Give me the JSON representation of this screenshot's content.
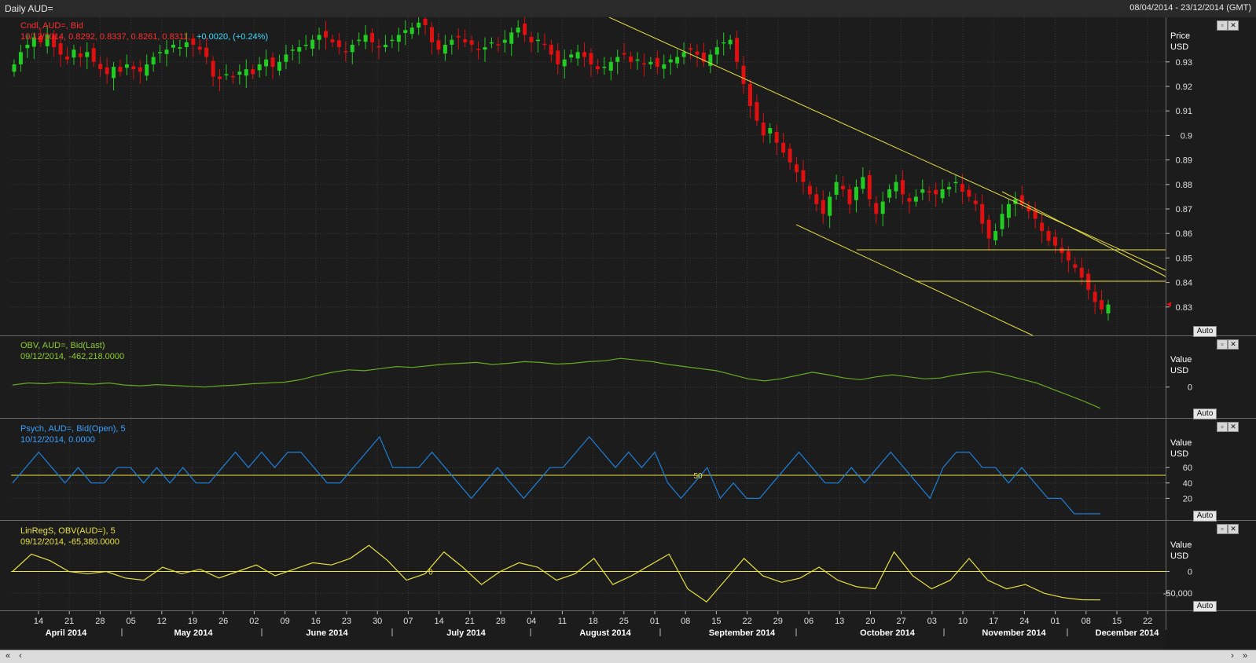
{
  "window": {
    "title": "Daily AUD=",
    "date_range": "08/04/2014 - 23/12/2014 (GMT)"
  },
  "colors": {
    "bg": "#1a1a1a",
    "up": "#22cc22",
    "down": "#e01010",
    "trend": "#e8e040",
    "obv": "#66aa22",
    "psych": "#1e7fd8",
    "linreg": "#e8e040",
    "grid": "#3a3a3a"
  },
  "icons": [
    "restore-icon",
    "close-icon",
    "scroll-left-icon",
    "scroll-right-icon"
  ],
  "auto_label": "Auto",
  "x_axis": {
    "day_ticks": [
      "14",
      "21",
      "28",
      "05",
      "12",
      "19",
      "26",
      "02",
      "09",
      "16",
      "23",
      "30",
      "07",
      "14",
      "21",
      "28",
      "04",
      "11",
      "18",
      "25",
      "01",
      "08",
      "15",
      "22",
      "29",
      "06",
      "13",
      "20",
      "27",
      "03",
      "10",
      "17",
      "24",
      "01",
      "08",
      "15",
      "22"
    ],
    "months": [
      "April 2014",
      "May 2014",
      "June 2014",
      "July 2014",
      "August 2014",
      "September 2014",
      "October 2014",
      "November 2014",
      "December 2014"
    ]
  },
  "panels": {
    "price": {
      "legend_line1": "Cndl, AUD=, Bid",
      "legend_line2a": "10/12/2014, 0.8292, 0.8337, 0.8261, 0.8311,",
      "legend_line2b": "+0.0020, (+0.24%)",
      "axis_title_1": "Price",
      "axis_title_2": "USD",
      "ticks": [
        "0.93",
        "0.92",
        "0.91",
        "0.9",
        "0.89",
        "0.88",
        "0.87",
        "0.86",
        "0.85",
        "0.84",
        "0.83"
      ]
    },
    "obv": {
      "legend_line1": "OBV, AUD=, Bid(Last)",
      "legend_line2": "09/12/2014, -462,218.0000",
      "axis_title_1": "Value",
      "axis_title_2": "USD",
      "ticks": [
        "0"
      ]
    },
    "psych": {
      "legend_line1": "Psych, AUD=, Bid(Open),  5",
      "legend_line2": "10/12/2014, 0.0000",
      "axis_title_1": "Value",
      "axis_title_2": "USD",
      "ticks": [
        "60",
        "40",
        "20"
      ],
      "ref_label": "50"
    },
    "linreg": {
      "legend_line1": "LinRegS, OBV(AUD=),  5",
      "legend_line2": "09/12/2014, -65,380.0000",
      "axis_title_1": "Value",
      "axis_title_2": "USD",
      "ticks": [
        "0",
        "-50,000"
      ],
      "ref_label": "0"
    }
  },
  "chart_data": [
    {
      "type": "candlestick",
      "title": "Cndl, AUD=, Bid",
      "ylabel": "Price USD",
      "ylim": [
        0.82,
        0.945
      ],
      "x_range": [
        "08/04/2014",
        "23/12/2014"
      ],
      "close": [
        0.929,
        0.934,
        0.937,
        0.94,
        0.938,
        0.941,
        0.936,
        0.933,
        0.931,
        0.935,
        0.932,
        0.934,
        0.93,
        0.927,
        0.925,
        0.928,
        0.926,
        0.929,
        0.927,
        0.926,
        0.929,
        0.932,
        0.934,
        0.935,
        0.937,
        0.936,
        0.938,
        0.937,
        0.935,
        0.932,
        0.924,
        0.923,
        0.925,
        0.924,
        0.926,
        0.927,
        0.925,
        0.929,
        0.931,
        0.928,
        0.93,
        0.933,
        0.935,
        0.936,
        0.937,
        0.939,
        0.941,
        0.94,
        0.938,
        0.936,
        0.934,
        0.937,
        0.939,
        0.941,
        0.938,
        0.936,
        0.937,
        0.939,
        0.941,
        0.943,
        0.944,
        0.946,
        0.945,
        0.938,
        0.935,
        0.937,
        0.939,
        0.94,
        0.938,
        0.937,
        0.935,
        0.936,
        0.938,
        0.937,
        0.939,
        0.942,
        0.944,
        0.941,
        0.938,
        0.939,
        0.937,
        0.933,
        0.929,
        0.931,
        0.933,
        0.934,
        0.932,
        0.929,
        0.927,
        0.928,
        0.93,
        0.932,
        0.933,
        0.93,
        0.931,
        0.929,
        0.93,
        0.928,
        0.929,
        0.931,
        0.932,
        0.934,
        0.935,
        0.933,
        0.93,
        0.933,
        0.936,
        0.938,
        0.939,
        0.93,
        0.921,
        0.912,
        0.906,
        0.9,
        0.903,
        0.897,
        0.893,
        0.889,
        0.885,
        0.881,
        0.876,
        0.872,
        0.868,
        0.875,
        0.881,
        0.878,
        0.872,
        0.879,
        0.883,
        0.874,
        0.868,
        0.873,
        0.878,
        0.881,
        0.876,
        0.873,
        0.875,
        0.878,
        0.877,
        0.876,
        0.878,
        0.879,
        0.881,
        0.877,
        0.875,
        0.872,
        0.864,
        0.858,
        0.861,
        0.868,
        0.872,
        0.874,
        0.872,
        0.869,
        0.866,
        0.861,
        0.857,
        0.855,
        0.852,
        0.849,
        0.846,
        0.842,
        0.837,
        0.832,
        0.829,
        0.831
      ],
      "overlays": [
        "descending channel upper trendline",
        "descending channel lower trendline",
        "horizontal support ~0.855",
        "horizontal support ~0.841"
      ]
    },
    {
      "type": "line",
      "title": "OBV, AUD=, Bid(Last)",
      "ylabel": "Value USD",
      "last": -462218,
      "series": [
        {
          "values": [
            0.05,
            0.1,
            0.08,
            0.12,
            0.09,
            0.07,
            0.1,
            0.05,
            0.03,
            0.06,
            0.04,
            0.02,
            0.0,
            0.03,
            0.05,
            0.08,
            0.1,
            0.12,
            0.18,
            0.28,
            0.36,
            0.42,
            0.4,
            0.45,
            0.5,
            0.48,
            0.52,
            0.56,
            0.58,
            0.6,
            0.55,
            0.58,
            0.62,
            0.6,
            0.56,
            0.58,
            0.62,
            0.64,
            0.7,
            0.66,
            0.62,
            0.55,
            0.5,
            0.45,
            0.4,
            0.3,
            0.2,
            0.15,
            0.2,
            0.28,
            0.36,
            0.3,
            0.22,
            0.18,
            0.25,
            0.3,
            0.25,
            0.2,
            0.22,
            0.3,
            0.35,
            0.38,
            0.3,
            0.2,
            0.1,
            -0.05,
            -0.2,
            -0.35,
            -0.52
          ]
        }
      ]
    },
    {
      "type": "line",
      "title": "Psych, AUD=, Bid(Open), 5",
      "ylabel": "Value USD",
      "last": 0.0,
      "reference": 50,
      "series": [
        {
          "values": [
            40,
            60,
            80,
            60,
            40,
            60,
            40,
            40,
            60,
            60,
            40,
            60,
            40,
            60,
            40,
            40,
            60,
            80,
            60,
            80,
            60,
            80,
            80,
            60,
            40,
            40,
            60,
            80,
            100,
            60,
            60,
            60,
            80,
            60,
            40,
            20,
            40,
            60,
            40,
            20,
            40,
            60,
            60,
            80,
            100,
            80,
            60,
            80,
            60,
            80,
            40,
            20,
            40,
            60,
            20,
            40,
            20,
            20,
            40,
            60,
            80,
            60,
            40,
            40,
            60,
            40,
            60,
            80,
            60,
            40,
            20,
            60,
            80,
            80,
            60,
            60,
            40,
            60,
            40,
            20,
            20,
            0,
            0,
            0
          ]
        }
      ]
    },
    {
      "type": "line",
      "title": "LinRegS, OBV(AUD=), 5",
      "ylabel": "Value USD",
      "last": -65380,
      "reference": 0,
      "series": [
        {
          "values": [
            0,
            40000,
            25000,
            0,
            -5000,
            0,
            -15000,
            -20000,
            10000,
            -5000,
            5000,
            -15000,
            0,
            15000,
            -10000,
            5000,
            20000,
            15000,
            30000,
            60000,
            25000,
            -20000,
            -5000,
            45000,
            10000,
            -30000,
            0,
            20000,
            10000,
            -20000,
            -5000,
            30000,
            -30000,
            -10000,
            15000,
            40000,
            -40000,
            -70000,
            -20000,
            30000,
            -10000,
            -25000,
            -15000,
            10000,
            -20000,
            -35000,
            -40000,
            45000,
            -10000,
            -40000,
            -20000,
            30000,
            -20000,
            -40000,
            -30000,
            -50000,
            -60000,
            -65000,
            -65380
          ]
        }
      ]
    }
  ]
}
